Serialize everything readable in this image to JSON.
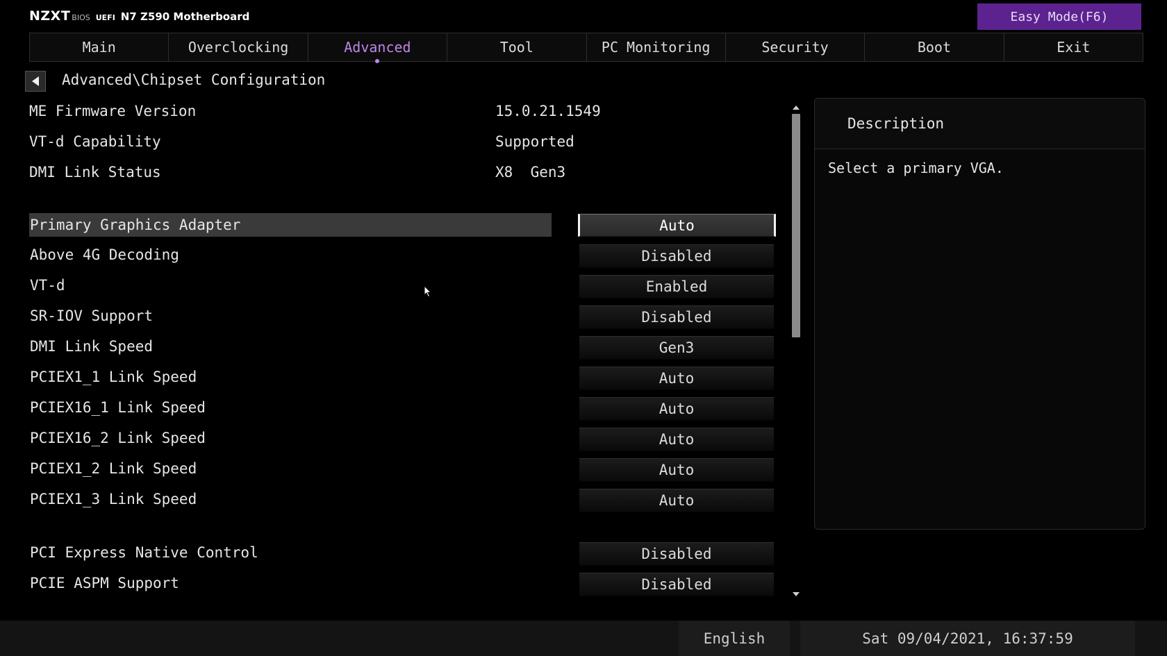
{
  "header": {
    "logo": "NZXT",
    "bios_label": "BIOS",
    "uefi_label": "UEFI",
    "model": "N7 Z590 Motherboard",
    "easy_mode_label": "Easy Mode(F6)",
    "accent_color": "#5c2390"
  },
  "tabs": [
    {
      "label": "Main",
      "active": false
    },
    {
      "label": "Overclocking",
      "active": false
    },
    {
      "label": "Advanced",
      "active": true
    },
    {
      "label": "Tool",
      "active": false
    },
    {
      "label": "PC Monitoring",
      "active": false
    },
    {
      "label": "Security",
      "active": false
    },
    {
      "label": "Boot",
      "active": false
    },
    {
      "label": "Exit",
      "active": false
    }
  ],
  "active_tab_color": "#c086e8",
  "breadcrumb": "Advanced\\Chipset Configuration",
  "info": [
    {
      "label": "ME Firmware Version",
      "value": "15.0.21.1549"
    },
    {
      "label": "VT-d Capability",
      "value": "Supported"
    },
    {
      "label": "DMI Link Status",
      "value": "X8  Gen3"
    }
  ],
  "settings": [
    {
      "label": "Primary Graphics Adapter",
      "value": "Auto",
      "selected": true
    },
    {
      "label": "Above 4G Decoding",
      "value": "Disabled"
    },
    {
      "label": "VT-d",
      "value": "Enabled"
    },
    {
      "label": "SR-IOV Support",
      "value": "Disabled"
    },
    {
      "label": "DMI Link Speed",
      "value": "Gen3"
    },
    {
      "label": "PCIEX1_1 Link Speed",
      "value": "Auto"
    },
    {
      "label": "PCIEX16_1 Link Speed",
      "value": "Auto"
    },
    {
      "label": "PCIEX16_2 Link Speed",
      "value": "Auto"
    },
    {
      "label": "PCIEX1_2 Link Speed",
      "value": "Auto"
    },
    {
      "label": "PCIEX1_3 Link Speed",
      "value": "Auto"
    },
    {
      "label": "PCI Express Native Control",
      "value": "Disabled"
    },
    {
      "label": "PCIE ASPM Support",
      "value": "Disabled"
    }
  ],
  "description": {
    "title": "Description",
    "text": "Select a primary VGA."
  },
  "status": {
    "language": "English",
    "datetime": "Sat 09/04/2021, 16:37:59"
  },
  "icons": {
    "back": "back-arrow-icon",
    "cursor": "mouse-pointer-icon"
  }
}
